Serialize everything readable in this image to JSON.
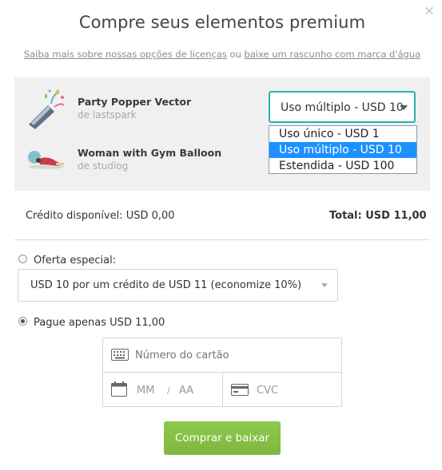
{
  "modal": {
    "close_symbol": "×",
    "title": "Compre seus elementos premium",
    "link_licenses": "Saiba mais sobre nossas opções de licenças",
    "link_connector": "ou",
    "link_draft": "baixe um rascunho com marca d'água"
  },
  "items": [
    {
      "title": "Party Popper Vector",
      "author": "de lastspark",
      "icon": "party-popper-thumbnail"
    },
    {
      "title": "Woman with Gym Balloon",
      "author": "de studiog",
      "icon": "gym-balloon-thumbnail"
    }
  ],
  "license_select": {
    "selected": "Uso múltiplo - USD 10",
    "options": [
      "Uso único - USD 1",
      "Uso múltiplo - USD 10",
      "Estendida - USD 100"
    ],
    "highlighted_index": 1
  },
  "summary": {
    "credit": "Crédito disponível: USD 0,00",
    "total": "Total: USD 11,00"
  },
  "special_offer": {
    "label": "Oferta especial:",
    "selected": "USD 10 por um crédito de USD 11 (economize 10%)",
    "checked": false
  },
  "pay_only": {
    "label": "Pague apenas USD 11,00",
    "checked": true
  },
  "card_form": {
    "card_number_placeholder": "Número do cartão",
    "month_placeholder": "MM",
    "separator": "/",
    "year_placeholder": "AA",
    "cvc_placeholder": "CVC"
  },
  "submit_label": "Comprar e baixar",
  "colors": {
    "accent_teal": "#27b3ae",
    "button_green": "#8bc34a",
    "option_highlight": "#1e90ff"
  }
}
